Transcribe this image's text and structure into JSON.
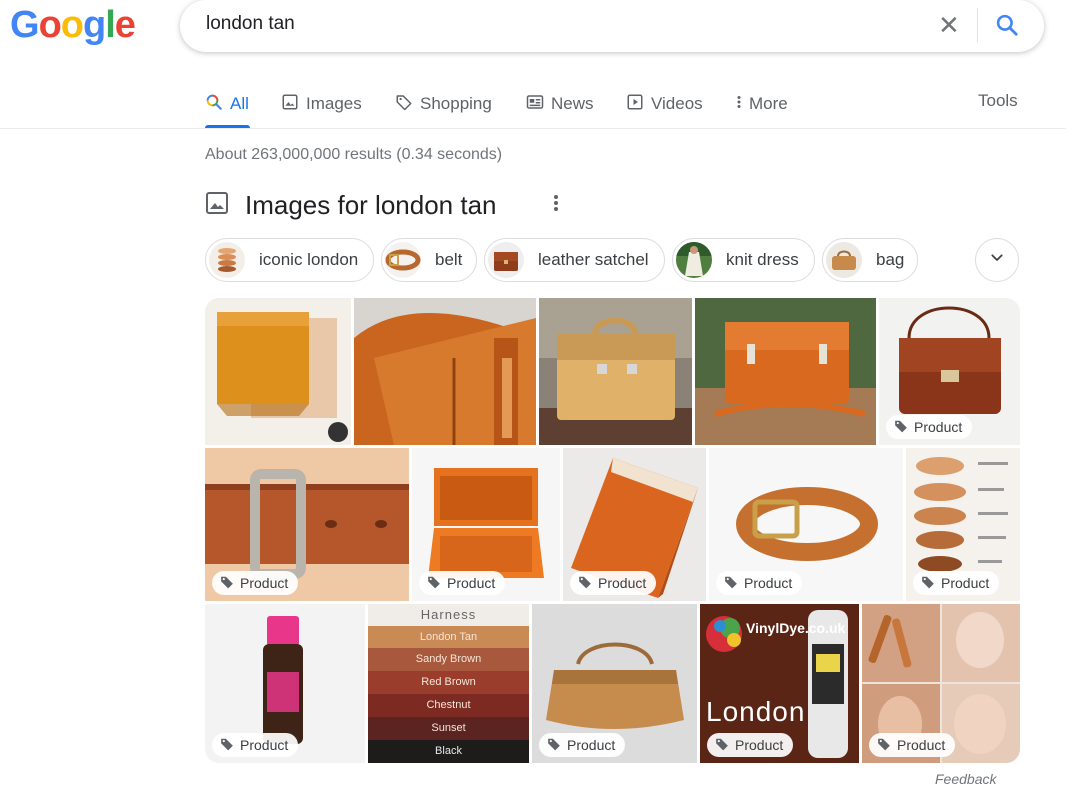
{
  "logo": {
    "letters": [
      "G",
      "o",
      "o",
      "g",
      "l",
      "e"
    ],
    "colors": [
      "#4285f4",
      "#ea4335",
      "#fbbc05",
      "#4285f4",
      "#34a853",
      "#ea4335"
    ]
  },
  "search": {
    "query": "london tan",
    "clear_icon": "close-icon",
    "submit_icon": "search-icon"
  },
  "tabs": [
    {
      "label": "All",
      "icon": "search-multicolor-icon",
      "active": true
    },
    {
      "label": "Images",
      "icon": "image-icon"
    },
    {
      "label": "Shopping",
      "icon": "tag-icon"
    },
    {
      "label": "News",
      "icon": "newspaper-icon"
    },
    {
      "label": "Videos",
      "icon": "play-icon"
    },
    {
      "label": "More",
      "icon": "vertical-dots-icon"
    }
  ],
  "tools_label": "Tools",
  "result_stats": "About 263,000,000 results (0.34 seconds)",
  "images_section": {
    "title": "Images for london tan",
    "menu_icon": "vertical-dots-icon"
  },
  "chips": [
    {
      "label": "iconic london"
    },
    {
      "label": "belt"
    },
    {
      "label": "leather satchel"
    },
    {
      "label": "knit dress"
    },
    {
      "label": "bag"
    }
  ],
  "chip_more_icon": "chevron-down-icon",
  "product_badge": "Product",
  "harness_swatch": {
    "heading": "Harness",
    "labels": [
      "London Tan",
      "Sandy Brown",
      "Red Brown",
      "Chestnut",
      "Sunset",
      "Black"
    ],
    "colors": [
      "#c98a56",
      "#a8583c",
      "#9a3d2c",
      "#7d2a22",
      "#5c2420",
      "#1e1b1b"
    ]
  },
  "vinyl_dye": {
    "brand": "VinylDye.co.uk",
    "word": "London"
  },
  "feedback_label": "Feedback",
  "accent_color": "#1a73e8"
}
